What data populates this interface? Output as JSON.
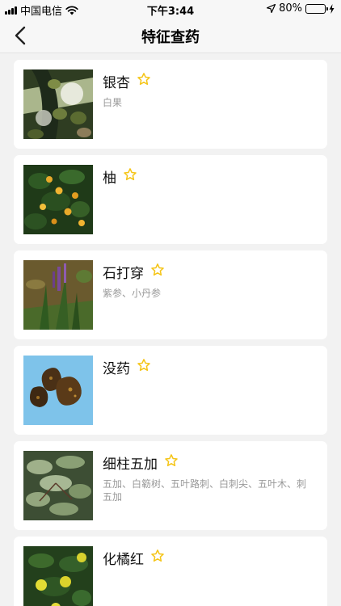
{
  "status_bar": {
    "carrier": "中国电信",
    "time": "下午3:44",
    "battery_percent": "80%",
    "battery_level": 0.8
  },
  "nav": {
    "title": "特征查药",
    "back_icon": "chevron-left-icon"
  },
  "colors": {
    "background": "#f2f2f2",
    "card": "#ffffff",
    "star": "#f5c518",
    "alias_text": "#999999",
    "battery_fill": "#4cd964"
  },
  "herbs": [
    {
      "name": "银杏",
      "alias": "白果",
      "favorited": false
    },
    {
      "name": "柚",
      "alias": "",
      "favorited": false
    },
    {
      "name": "石打穿",
      "alias": "紫参、小丹参",
      "favorited": false
    },
    {
      "name": "没药",
      "alias": "",
      "favorited": false
    },
    {
      "name": "细柱五加",
      "alias": "五加、白簕树、五叶路刺、白刺尖、五叶木、刺五加",
      "favorited": false
    },
    {
      "name": "化橘红",
      "alias": "",
      "favorited": false
    }
  ]
}
